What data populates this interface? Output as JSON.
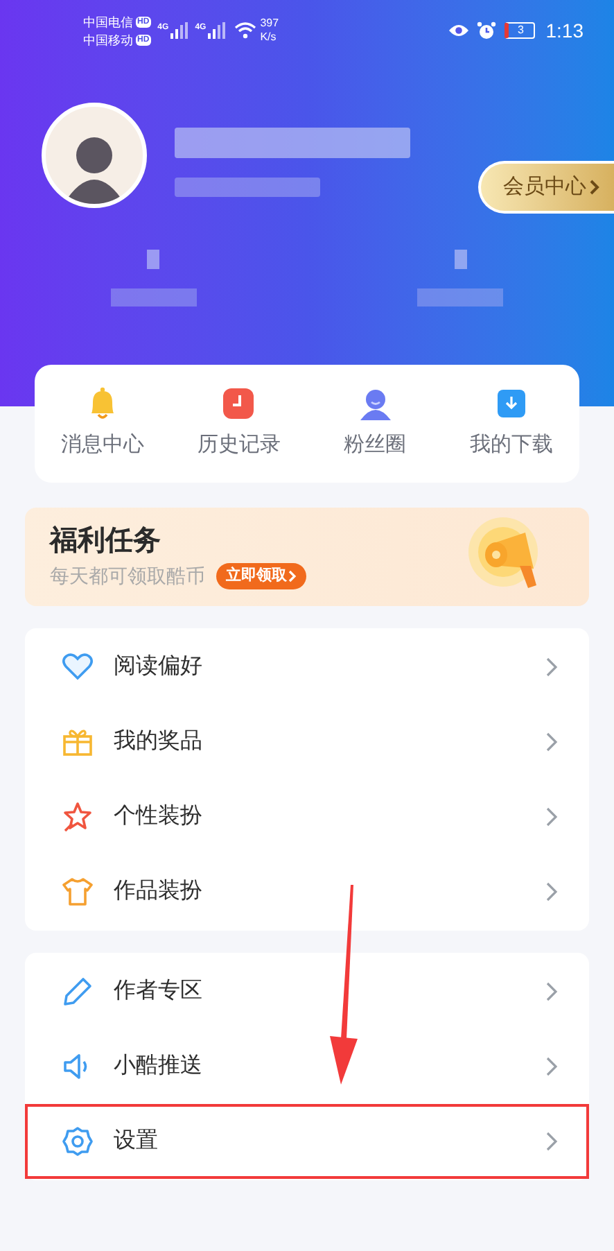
{
  "status_bar": {
    "carriers": [
      {
        "name": "中国电信",
        "badge": "HD"
      },
      {
        "name": "中国移动",
        "badge": "HD"
      }
    ],
    "networks": [
      "4G",
      "4G"
    ],
    "speed": "397",
    "speed_unit": "K/s",
    "battery": "3",
    "time": "1:13"
  },
  "profile": {
    "member_button": "会员中心"
  },
  "quick_actions": [
    {
      "kind": "bell",
      "label": "消息中心"
    },
    {
      "kind": "history",
      "label": "历史记录"
    },
    {
      "kind": "fans",
      "label": "粉丝圈"
    },
    {
      "kind": "download",
      "label": "我的下载"
    }
  ],
  "banner": {
    "title": "福利任务",
    "subtitle": "每天都可领取酷币",
    "button": "立即领取"
  },
  "menu_groups": [
    {
      "items": [
        {
          "kind": "heart",
          "label": "阅读偏好",
          "highlighted": false
        },
        {
          "kind": "gift",
          "label": "我的奖品",
          "highlighted": false
        },
        {
          "kind": "star",
          "label": "个性装扮",
          "highlighted": false
        },
        {
          "kind": "shirt",
          "label": "作品装扮",
          "highlighted": false
        }
      ]
    },
    {
      "items": [
        {
          "kind": "pencil",
          "label": "作者专区",
          "highlighted": false
        },
        {
          "kind": "speaker",
          "label": "小酷推送",
          "highlighted": false
        },
        {
          "kind": "gear",
          "label": "设置",
          "highlighted": true
        }
      ]
    }
  ]
}
